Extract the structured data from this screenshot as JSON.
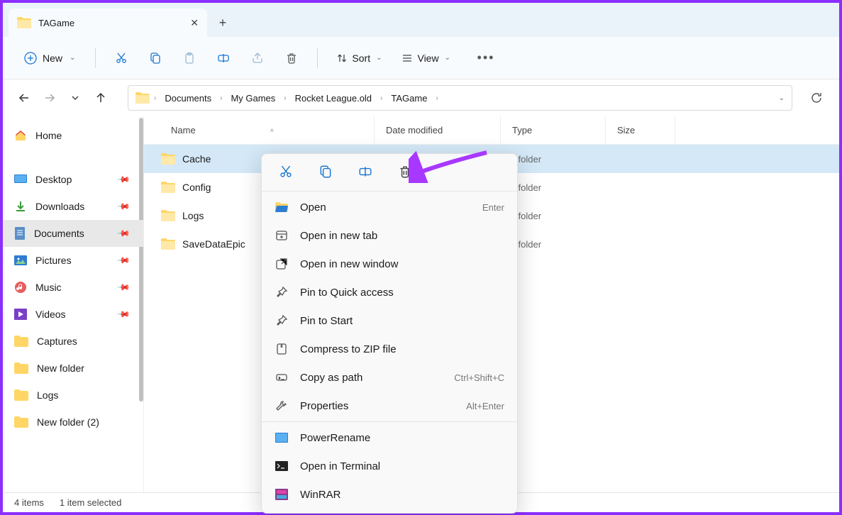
{
  "tab": {
    "title": "TAGame"
  },
  "toolbar": {
    "new_label": "New",
    "sort_label": "Sort",
    "view_label": "View"
  },
  "breadcrumb": [
    "Documents",
    "My Games",
    "Rocket League.old",
    "TAGame"
  ],
  "columns": {
    "name": "Name",
    "date": "Date modified",
    "type": "Type",
    "size": "Size"
  },
  "sidebar": {
    "home": "Home",
    "items": [
      {
        "label": "Desktop",
        "pinned": true
      },
      {
        "label": "Downloads",
        "pinned": true
      },
      {
        "label": "Documents",
        "pinned": true,
        "active": true
      },
      {
        "label": "Pictures",
        "pinned": true
      },
      {
        "label": "Music",
        "pinned": true
      },
      {
        "label": "Videos",
        "pinned": true
      },
      {
        "label": "Captures",
        "pinned": false
      },
      {
        "label": "New folder",
        "pinned": false
      },
      {
        "label": "Logs",
        "pinned": false
      },
      {
        "label": "New folder (2)",
        "pinned": false
      }
    ]
  },
  "rows": [
    {
      "name": "Cache",
      "type": "File folder",
      "selected": true
    },
    {
      "name": "Config",
      "type": "File folder"
    },
    {
      "name": "Logs",
      "type": "File folder"
    },
    {
      "name": "SaveDataEpic",
      "type": "File folder"
    }
  ],
  "context_menu": {
    "open": "Open",
    "open_sc": "Enter",
    "open_tab": "Open in new tab",
    "open_win": "Open in new window",
    "pin_qa": "Pin to Quick access",
    "pin_start": "Pin to Start",
    "zip": "Compress to ZIP file",
    "copy_path": "Copy as path",
    "copy_path_sc": "Ctrl+Shift+C",
    "properties": "Properties",
    "properties_sc": "Alt+Enter",
    "power_rename": "PowerRename",
    "terminal": "Open in Terminal",
    "winrar": "WinRAR"
  },
  "status": {
    "count": "4 items",
    "selected": "1 item selected"
  }
}
